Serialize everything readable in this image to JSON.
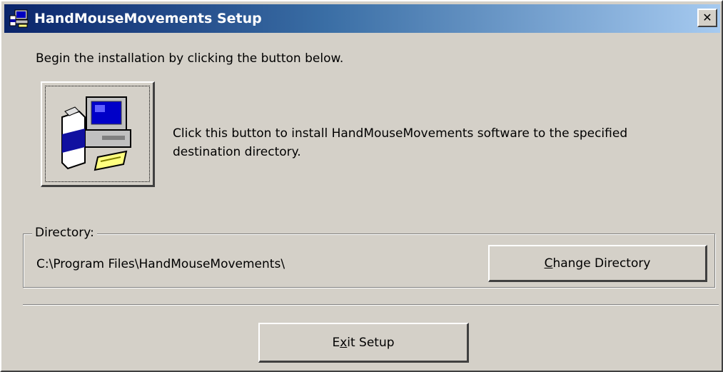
{
  "window": {
    "title": "HandMouseMovements Setup",
    "close_label": "✕",
    "title_icon": "setup-computer-icon"
  },
  "intro_text": "Begin the installation by clicking the button below.",
  "install": {
    "icon": "setup-computer-icon",
    "description": "Click this button to install HandMouseMovements software to the specified destination directory."
  },
  "directory": {
    "legend": "Directory:",
    "path": "C:\\Program Files\\HandMouseMovements\\",
    "change_label_mnemonic": "C",
    "change_label_rest": "hange Directory"
  },
  "exit": {
    "label_before": "E",
    "label_mnemonic": "x",
    "label_after": "it Setup"
  },
  "colors": {
    "face": "#d4d0c8",
    "titlebar_start": "#0a246a",
    "titlebar_end": "#a6caf0"
  }
}
